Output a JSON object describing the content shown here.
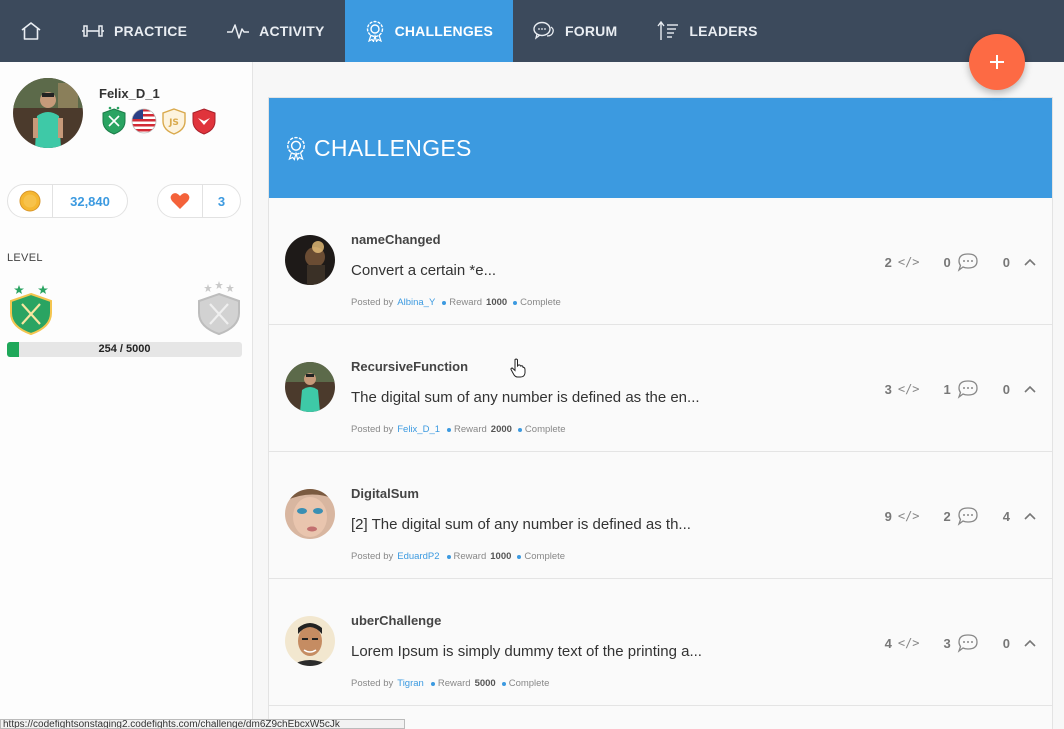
{
  "nav": {
    "items": [
      {
        "label": "PRACTICE"
      },
      {
        "label": "ACTIVITY"
      },
      {
        "label": "CHALLENGES"
      },
      {
        "label": "FORUM"
      },
      {
        "label": "LEADERS"
      }
    ],
    "active": "CHALLENGES",
    "accent_color": "#3c9ae0",
    "bar_color": "#3c4a5c"
  },
  "fab": {
    "icon": "plus-icon",
    "color": "#fd6a44"
  },
  "profile": {
    "username": "Felix_D_1",
    "badges": [
      "shield-badge-icon",
      "usa-flag-badge-icon",
      "js-badge-icon",
      "red-badge-icon"
    ],
    "coins": "32,840",
    "likes": "3",
    "level_label": "LEVEL",
    "progress_text": "254 / 5000",
    "progress_fraction": 0.0508
  },
  "challenges": {
    "header": "CHALLENGES",
    "posted_by_label": "Posted by",
    "reward_label": "Reward",
    "items": [
      {
        "name": "nameChanged",
        "description": "Convert a certain *e...",
        "author": "Albina_Y",
        "reward": "1000",
        "status": "Complete",
        "solutions": "2",
        "comments": "0",
        "votes": "0"
      },
      {
        "name": "RecursiveFunction",
        "description": "The digital sum of any number is defined as the en...",
        "author": "Felix_D_1",
        "reward": "2000",
        "status": "Complete",
        "solutions": "3",
        "comments": "1",
        "votes": "0"
      },
      {
        "name": "DigitalSum",
        "description": "[2] The digital sum of any number is defined as th...",
        "author": "EduardP2",
        "reward": "1000",
        "status": "Complete",
        "solutions": "9",
        "comments": "2",
        "votes": "4"
      },
      {
        "name": "uberChallenge",
        "description": "Lorem Ipsum is simply dummy text of the printing a...",
        "author": "Tigran",
        "reward": "5000",
        "status": "Complete",
        "solutions": "4",
        "comments": "3",
        "votes": "0"
      }
    ]
  },
  "statusbar": {
    "url": "https://codefightsonstaging2.codefights.com/challenge/dm6Z9chEbcxW5cJk"
  }
}
